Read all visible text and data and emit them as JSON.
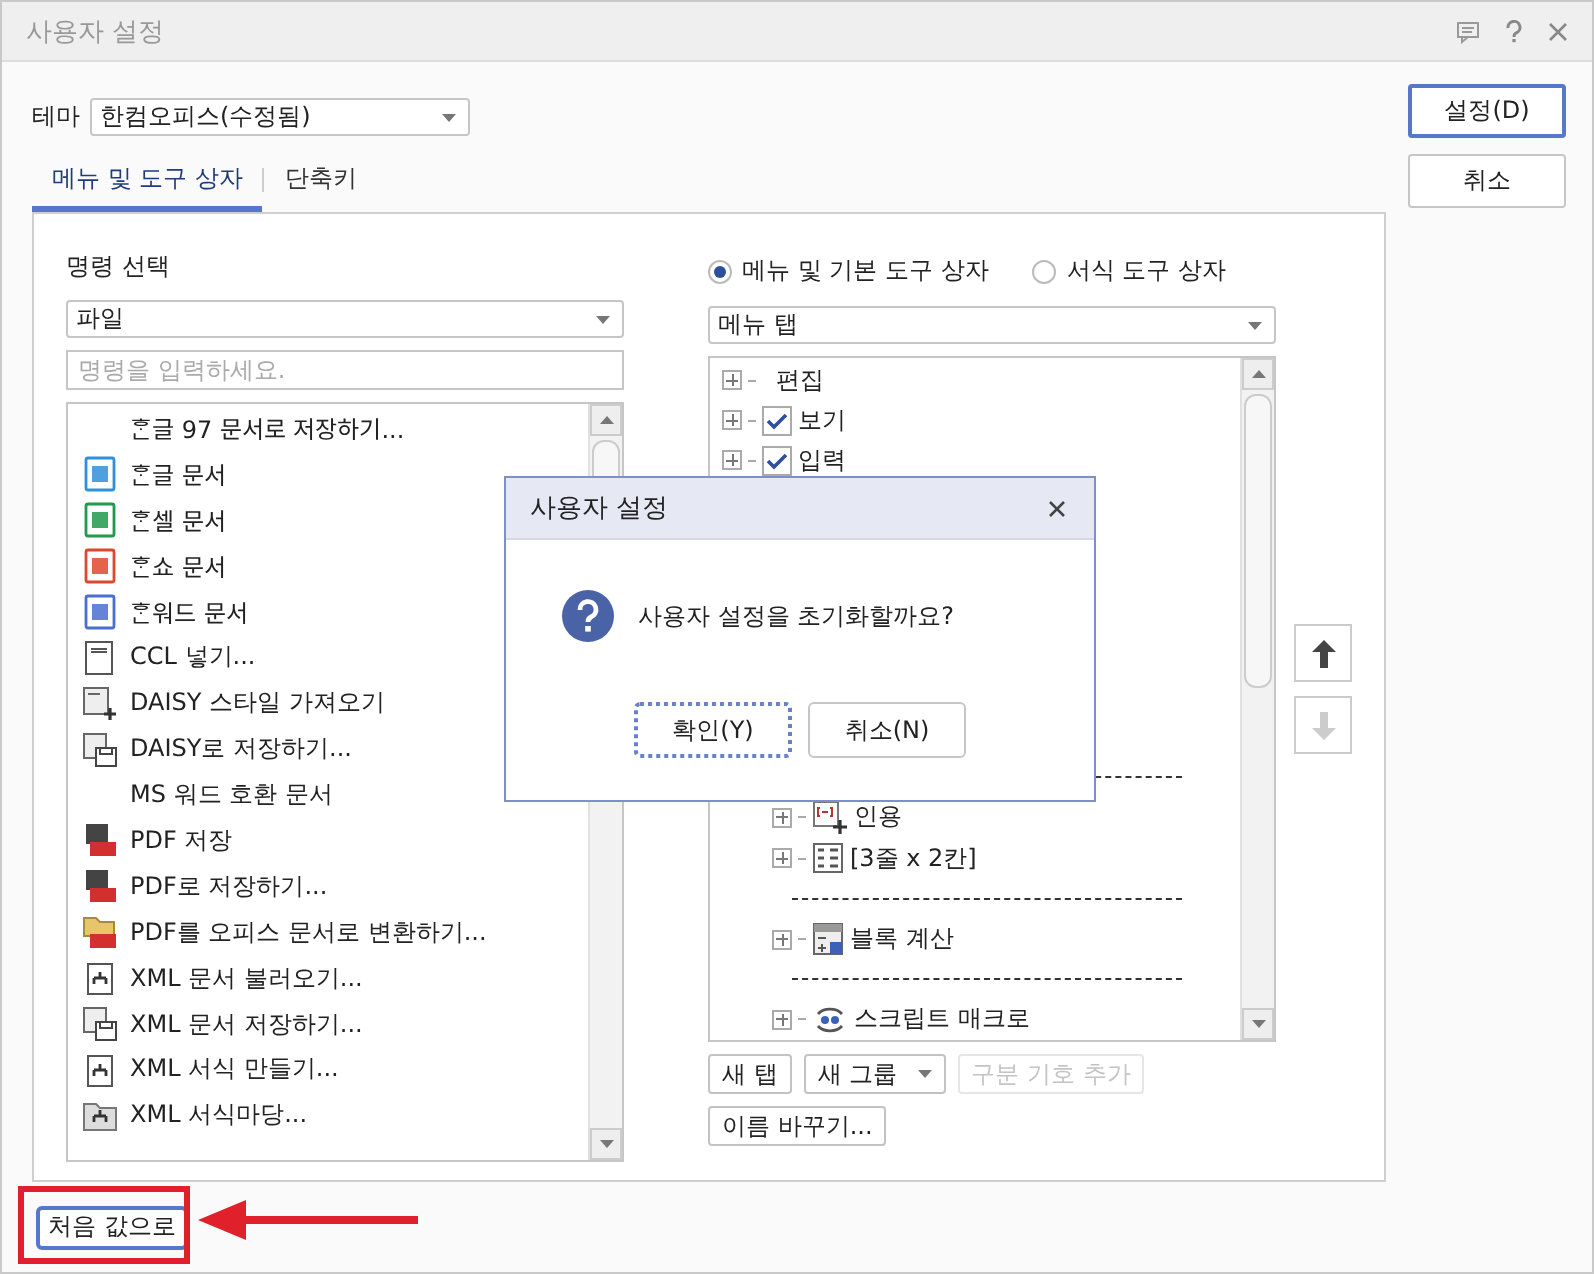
{
  "window": {
    "title": "사용자 설정"
  },
  "theme": {
    "label": "테마",
    "value": "한컴오피스(수정됨)"
  },
  "tabs": [
    {
      "label": "메뉴 및 도구 상자",
      "selected": true
    },
    {
      "label": "단축키",
      "selected": false
    }
  ],
  "command_select": {
    "label": "명령 선택",
    "category": "파일",
    "search_placeholder": "명령을 입력하세요.",
    "items": [
      {
        "kind": "none",
        "label": "ᄒᆞᆫ글 97 문서로 저장하기..."
      },
      {
        "kind": "hwp",
        "label": "ᄒᆞᆫ글 문서"
      },
      {
        "kind": "cell",
        "label": "ᄒᆞᆫ셀 문서"
      },
      {
        "kind": "show",
        "label": "ᄒᆞᆫ쇼 문서"
      },
      {
        "kind": "word",
        "label": "ᄒᆞᆫ워드 문서"
      },
      {
        "kind": "ccl",
        "label": "CCL 넣기..."
      },
      {
        "kind": "daisy-import",
        "label": "DAISY 스타일 가져오기"
      },
      {
        "kind": "daisy-save",
        "label": "DAISY로 저장하기..."
      },
      {
        "kind": "none",
        "label": "MS 워드 호환 문서"
      },
      {
        "kind": "pdf",
        "label": "PDF 저장"
      },
      {
        "kind": "pdf",
        "label": "PDF로 저장하기..."
      },
      {
        "kind": "pdf-folder",
        "label": "PDF를 오피스 문서로 변환하기..."
      },
      {
        "kind": "xml-open",
        "label": "XML 문서 불러오기..."
      },
      {
        "kind": "xml-save",
        "label": "XML 문서 저장하기..."
      },
      {
        "kind": "xml",
        "label": "XML 서식 만들기..."
      },
      {
        "kind": "xml-folder",
        "label": "XML 서식마당..."
      }
    ]
  },
  "toolbox": {
    "radios": [
      {
        "label": "메뉴 및 기본 도구 상자",
        "selected": true
      },
      {
        "label": "서식 도구 상자",
        "selected": false
      }
    ],
    "target": "메뉴 탭",
    "tree_top": [
      {
        "kind": "plain",
        "label": "편집"
      },
      {
        "kind": "check",
        "label": "보기",
        "checked": true
      },
      {
        "kind": "check",
        "label": "입력",
        "checked": true
      }
    ],
    "tree_lower": [
      {
        "kind": "separator"
      },
      {
        "kind": "quote",
        "label": "인용"
      },
      {
        "kind": "grid",
        "label": "[3줄 x 2칸]"
      },
      {
        "kind": "separator"
      },
      {
        "kind": "calc",
        "label": "블록 계산"
      },
      {
        "kind": "separator"
      },
      {
        "kind": "macro",
        "label": "스크립트 매크로"
      }
    ],
    "move_buttons": [
      {
        "kind": "up",
        "disabled": false
      },
      {
        "kind": "down",
        "disabled": true
      }
    ],
    "button_rows": [
      [
        {
          "label": "새 탭",
          "kind": "plain",
          "disabled": false
        },
        {
          "label": "새 그룹",
          "kind": "dropdown",
          "disabled": false
        },
        {
          "label": "구분 기호 추가",
          "kind": "plain",
          "disabled": true
        }
      ],
      [
        {
          "label": "이름 바꾸기...",
          "kind": "plain",
          "disabled": false
        }
      ]
    ]
  },
  "side_buttons": [
    {
      "label": "설정(D)",
      "default": true
    },
    {
      "label": "취소",
      "default": false
    }
  ],
  "reset_button": "처음 값으로",
  "dialog": {
    "title": "사용자 설정",
    "message": "사용자 설정을 초기화할까요?",
    "buttons": [
      {
        "label": "확인(Y)",
        "focused": true
      },
      {
        "label": "취소(N)",
        "focused": false
      }
    ]
  }
}
